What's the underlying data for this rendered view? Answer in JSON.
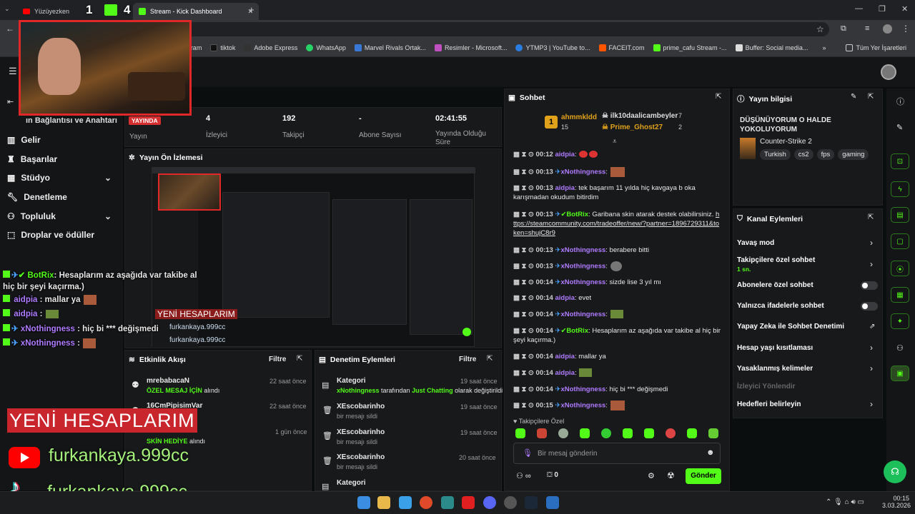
{
  "browser": {
    "tabs": [
      {
        "title": "Yüzüyezken"
      },
      {
        "title": "Stream - Kick Dashboard"
      }
    ],
    "bookmarks": [
      "(1) Instagram",
      "tiktok",
      "Adobe Express",
      "WhatsApp",
      "Marvel Rivals Ortak...",
      "Resimler - Microsoft...",
      "YTMP3 | YouTube to...",
      "FACEIT.com",
      "prime_cafu Stream -...",
      "Buffer: Social media..."
    ],
    "all_bookmarks": "Tüm Yer İşaretleri"
  },
  "webcam": {
    "overlay_count_1": "1",
    "overlay_count_2": "4"
  },
  "sidebar": {
    "partial_title": "ın Bağlantısı ve Anahtarı",
    "items": [
      {
        "label": "Gelir",
        "icon": "chart-icon"
      },
      {
        "label": "Başarılar",
        "icon": "trophy-icon"
      },
      {
        "label": "Stüdyo",
        "icon": "grid-icon",
        "expand": true
      },
      {
        "label": "Denetleme",
        "icon": "wrench-icon"
      },
      {
        "label": "Topluluk",
        "icon": "users-icon",
        "expand": true
      },
      {
        "label": "Droplar ve ödüller",
        "icon": "gift-icon"
      }
    ]
  },
  "stats": {
    "live_badge": "YAYINDA",
    "stream_label": "Yayın",
    "viewers": {
      "value": "4",
      "label": "İzleyici"
    },
    "followers": {
      "value": "192",
      "label": "Takipçi"
    },
    "subscribers": {
      "value": "-",
      "label": "Abone Sayısı"
    },
    "uptime": {
      "value": "02:41:55",
      "label": "Yayında Olduğu Süre"
    }
  },
  "preview": {
    "title": "Yayın Ön İzlemesi",
    "overlay_text": "YENİ HESAPLARIM",
    "handle_1": "furkankaya.999cc",
    "handle_2": "furkankaya.999cc"
  },
  "activity": {
    "title": "Etkinlik Akışı",
    "filter": "Filtre",
    "items": [
      {
        "name": "mrebabacaN",
        "time": "22 saat önce",
        "highlight": "ÖZEL MESAJ İÇİN",
        "rest": " alındı"
      },
      {
        "name": "16CmPipisimVar",
        "time": "22 saat önce",
        "highlight": "",
        "rest": ""
      },
      {
        "name": "",
        "time": "1 gün önce",
        "highlight": "SKİN HEDİYE",
        "rest": " alındı"
      }
    ]
  },
  "moderation": {
    "title": "Denetim Eylemleri",
    "filter": "Filtre",
    "items": [
      {
        "title": "Kategori",
        "time": "19 saat önce",
        "user": "xNothingness",
        "mid": " tarafından ",
        "cat": "Just Chatting",
        "end": " olarak değiştirildi"
      },
      {
        "title": "XEscobarinho",
        "time": "19 saat önce",
        "desc": "bir mesajı sildi"
      },
      {
        "title": "XEscobarinho",
        "time": "19 saat önce",
        "desc": "bir mesajı sildi"
      },
      {
        "title": "XEscobarinho",
        "time": "20 saat önce",
        "desc": "bir mesajı sildi"
      },
      {
        "title": "Kategori",
        "time": "",
        "desc": ""
      }
    ]
  },
  "chat": {
    "title": "Sohbet",
    "leaders": [
      {
        "rank": "1",
        "name": "ahmmkldd",
        "count": "15"
      },
      {
        "name": "ilk10daalicambeyler",
        "count": "7"
      },
      {
        "name": "Prime_Ghost27",
        "count": "2"
      }
    ],
    "messages": [
      {
        "time": "00:12",
        "user": "aidpia",
        "text": ""
      },
      {
        "time": "00:13",
        "user": "xNothingness",
        "text": ""
      },
      {
        "time": "00:13",
        "user": "aidpia",
        "text": "tek başarım 11 yılda hiç kavgaya b oka karışmadan okudum bitirdim"
      },
      {
        "time": "00:13",
        "user": "BotRix",
        "text": "Garibana skin atarak destek olabilirsiniz. ",
        "link": "https://steamcommunity.com/tradeoffer/new/?partner=1896729311&token=shujC8r9"
      },
      {
        "time": "00:13",
        "user": "xNothingness",
        "text": "berabere bitti"
      },
      {
        "time": "00:13",
        "user": "xNothingness",
        "text": ""
      },
      {
        "time": "00:14",
        "user": "xNothingness",
        "text": "sizde lise 3 yıl mı"
      },
      {
        "time": "00:14",
        "user": "aidpia",
        "text": "evet"
      },
      {
        "time": "00:14",
        "user": "xNothingness",
        "text": ""
      },
      {
        "time": "00:14",
        "user": "BotRix",
        "text": "Hesaplarım az aşağıda var takibe al hiç bir şeyi kaçırma.)"
      },
      {
        "time": "00:14",
        "user": "aidpia",
        "text": "mallar ya"
      },
      {
        "time": "00:14",
        "user": "aidpia",
        "text": ""
      },
      {
        "time": "00:14",
        "user": "xNothingness",
        "text": "hiç bi *** değişmedi"
      },
      {
        "time": "00:15",
        "user": "xNothingness",
        "text": ""
      }
    ],
    "followers_only_label": "Takipçilere Özel",
    "input_placeholder": "Bir mesaj gönderin",
    "points": "0",
    "send": "Gönder"
  },
  "stream_info": {
    "title": "Yayın bilgisi",
    "stream_title": "DÜŞÜNÜYORUM O HALDE YOKOLUYORUM",
    "game": "Counter-Strike 2",
    "tags": [
      "Turkish",
      "cs2",
      "fps",
      "gaming"
    ]
  },
  "channel_actions": {
    "title": "Kanal Eylemleri",
    "rows": [
      {
        "label": "Yavaş mod",
        "kind": "chevron"
      },
      {
        "label": "Takipçilere özel sohbet",
        "sub": "1 sn.",
        "kind": "chevron"
      },
      {
        "label": "Abonelere özel sohbet",
        "kind": "toggle"
      },
      {
        "label": "Yalnızca ifadelerle sohbet",
        "kind": "toggle"
      },
      {
        "label": "Yapay Zeka ile Sohbet Denetimi",
        "kind": "external"
      },
      {
        "label": "Hesap yaşı kısıtlaması",
        "kind": "chevron"
      },
      {
        "label": "Yasaklanmış kelimeler",
        "kind": "chevron"
      },
      {
        "label": "İzleyici Yönlendir",
        "kind": "disabled"
      },
      {
        "label": "Hedefleri belirleyin",
        "kind": "chevron"
      }
    ]
  },
  "overlay": {
    "chat": [
      {
        "user": "BotRix",
        "text": ": Hesaplarım az aşağıda var takibe al hiç bir şeyi kaçırma.)"
      },
      {
        "user": "aidpia",
        "text": ": mallar ya"
      },
      {
        "user": "aidpia",
        "text": ":"
      },
      {
        "user": "xNothingness",
        "text": ": hiç bi *** değişmedi"
      },
      {
        "user": "xNothingness",
        "text": ":"
      }
    ],
    "banner": "YENİ HESAPLARIM",
    "youtube": "furkankaya.999cc",
    "tiktok": "furkankaya.999cc"
  },
  "taskbar": {
    "time": "00:15",
    "date": "3.03.2026"
  },
  "colors": {
    "kick_green": "#53fc18",
    "purple": "#b07cff",
    "panel": "#18191b",
    "banner_red": "#c8262c"
  }
}
